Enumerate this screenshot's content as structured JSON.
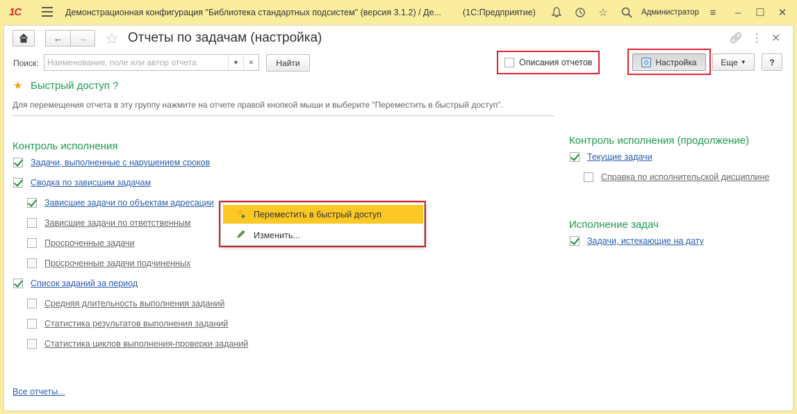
{
  "titlebar": {
    "logo": "1С",
    "title": "Демонстрационная конфигурация \"Библиотека стандартных подсистем\" (версия 3.1.2) / Де...",
    "platform": "(1С:Предприятие)",
    "user": "Администратор"
  },
  "page": {
    "title": "Отчеты по задачам (настройка)"
  },
  "toolbar": {
    "search_label": "Поиск:",
    "search_placeholder": "Наименование, поле или автор отчета",
    "find_label": "Найти",
    "descriptions_label": "Описания отчетов",
    "settings_label": "Настройка",
    "more_label": "Еще",
    "help_label": "?"
  },
  "quick_access": {
    "title": "Быстрый доступ",
    "help": "?",
    "hint": "Для перемещения отчета в эту группу нажмите на отчете правой кнопкой мыши и выберите \"Переместить в быстрый доступ\"."
  },
  "left_group": {
    "title": "Контроль исполнения",
    "items": [
      {
        "label": "Задачи, выполненные с нарушением сроков",
        "checked": true
      },
      {
        "label": "Сводка по зависшим задачам",
        "checked": true
      },
      {
        "label": "Зависшие задачи по объектам адресации",
        "checked": true
      },
      {
        "label": "Зависшие задачи по ответственным",
        "checked": false
      },
      {
        "label": "Просроченные задачи",
        "checked": false
      },
      {
        "label": "Просроченные задачи подчиненных",
        "checked": false
      },
      {
        "label": "Список заданий за период",
        "checked": true
      },
      {
        "label": "Средняя длительность выполнения заданий",
        "checked": false
      },
      {
        "label": "Статистика результатов выполнения заданий",
        "checked": false
      },
      {
        "label": "Статистика циклов выполнения-проверки заданий",
        "checked": false
      }
    ]
  },
  "right_group_1": {
    "title": "Контроль исполнения (продолжение)",
    "items": [
      {
        "label": "Текущие задачи",
        "checked": true
      },
      {
        "label": "Справка по исполнительской дисциплине",
        "checked": false
      }
    ]
  },
  "right_group_2": {
    "title": "Исполнение задач",
    "items": [
      {
        "label": "Задачи, истекающие на дату",
        "checked": true
      }
    ]
  },
  "context_menu": {
    "items": [
      {
        "label": "Переместить в быстрый доступ",
        "icon": "star-plus-icon"
      },
      {
        "label": "Изменить...",
        "icon": "pencil-icon"
      }
    ]
  },
  "footer": {
    "all_reports": "Все отчеты..."
  },
  "colors": {
    "accent_green": "#1d9a4f",
    "highlight_red": "#e3202f",
    "menu_hover": "#fbc826",
    "titlebar_bg": "#fbed9e"
  }
}
